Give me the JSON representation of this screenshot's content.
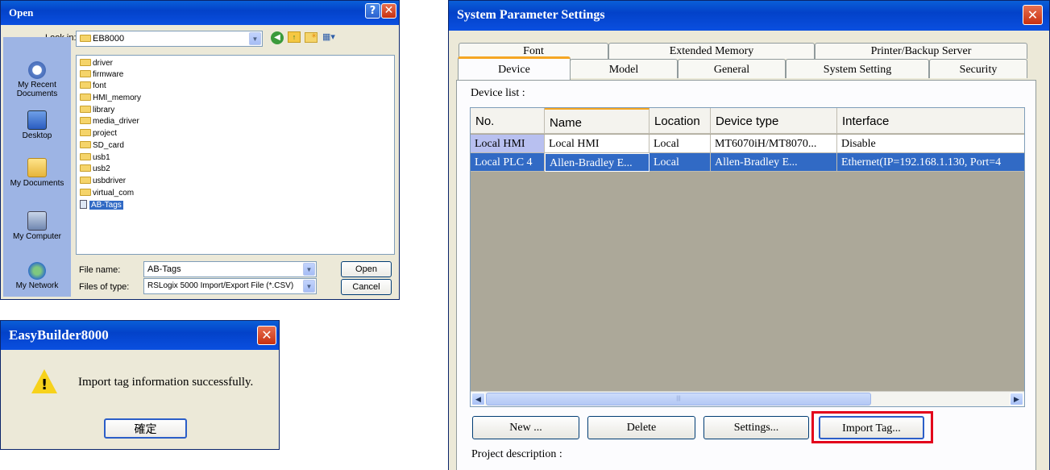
{
  "open_dialog": {
    "title": "Open",
    "look_in_label": "Look in:",
    "look_in_value": "EB8000",
    "places": [
      "My Recent Documents",
      "Desktop",
      "My Documents",
      "My Computer",
      "My Network"
    ],
    "files": [
      {
        "name": "driver",
        "type": "folder"
      },
      {
        "name": "firmware",
        "type": "folder"
      },
      {
        "name": "font",
        "type": "folder"
      },
      {
        "name": "HMI_memory",
        "type": "folder"
      },
      {
        "name": "library",
        "type": "folder"
      },
      {
        "name": "media_driver",
        "type": "folder"
      },
      {
        "name": "project",
        "type": "folder"
      },
      {
        "name": "SD_card",
        "type": "folder"
      },
      {
        "name": "usb1",
        "type": "folder"
      },
      {
        "name": "usb2",
        "type": "folder"
      },
      {
        "name": "usbdriver",
        "type": "folder"
      },
      {
        "name": "virtual_com",
        "type": "folder"
      },
      {
        "name": "AB-Tags",
        "type": "file",
        "selected": true
      }
    ],
    "file_name_label": "File name:",
    "file_name_value": "AB-Tags",
    "files_of_type_label": "Files of type:",
    "files_of_type_value": "RSLogix 5000 Import/Export File (*.CSV)",
    "open_button": "Open",
    "cancel_button": "Cancel"
  },
  "message_box": {
    "title": "EasyBuilder8000",
    "message": "Import tag information successfully.",
    "ok_button": "確定",
    "icon": "warning-icon"
  },
  "system_params": {
    "title": "System Parameter Settings",
    "tabs_back": [
      "Font",
      "Extended Memory",
      "Printer/Backup Server"
    ],
    "tabs_front": [
      "Device",
      "Model",
      "General",
      "System Setting",
      "Security"
    ],
    "active_tab": "Device",
    "device_list_label": "Device list :",
    "columns": [
      "No.",
      "Name",
      "Location",
      "Device type",
      "Interface"
    ],
    "rows": [
      {
        "no": "Local HMI",
        "name": "Local HMI",
        "location": "Local",
        "device_type": "MT6070iH/MT8070...",
        "interface": "Disable"
      },
      {
        "no": "Local PLC 4",
        "name": "Allen-Bradley E...",
        "location": "Local",
        "device_type": "Allen-Bradley E...",
        "interface": "Ethernet(IP=192.168.1.130, Port=4",
        "selected": true
      }
    ],
    "buttons": [
      "New ...",
      "Delete",
      "Settings...",
      "Import Tag..."
    ],
    "highlighted_button": "Import Tag...",
    "highlight_color": "#e3001b",
    "project_description_label": "Project description :"
  }
}
